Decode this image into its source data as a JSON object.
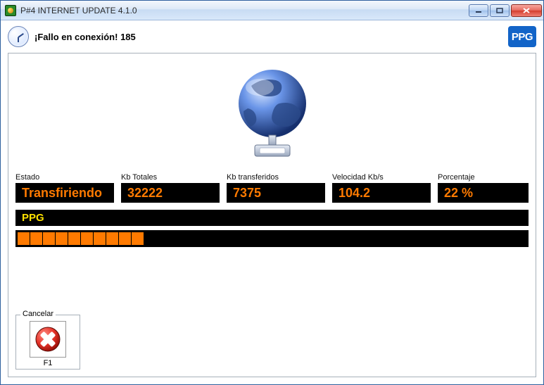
{
  "window": {
    "title": "P#4 INTERNET UPDATE 4.1.0"
  },
  "header": {
    "status_text": "¡Fallo en conexión! 185",
    "logo_text": "PPG"
  },
  "stats": {
    "estado": {
      "label": "Estado",
      "value": "Transfiriendo"
    },
    "kb_totales": {
      "label": "Kb Totales",
      "value": "32222"
    },
    "kb_transferidos": {
      "label": "Kb transferidos",
      "value": "7375"
    },
    "velocidad": {
      "label": "Velocidad Kb/s",
      "value": "104.2"
    },
    "porcentaje": {
      "label": "Porcentaje",
      "value": "22 %"
    }
  },
  "transfer_name": "PPG",
  "progress": {
    "percent": 22,
    "segments_filled": 10
  },
  "cancel": {
    "group_label": "Cancelar",
    "shortcut": "F1"
  }
}
